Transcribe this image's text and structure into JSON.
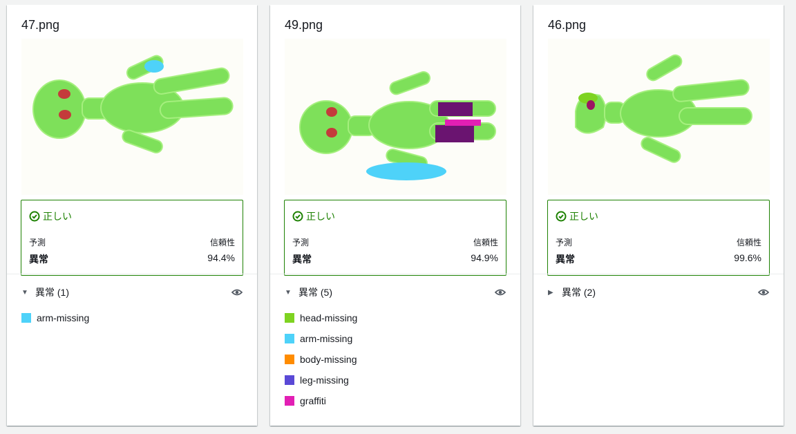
{
  "cards": [
    {
      "title": "47.png",
      "status": "正しい",
      "prediction_label": "予測",
      "confidence_label": "信頼性",
      "prediction_value": "異常",
      "confidence_value": "94.4%",
      "anomaly_header": "異常 (1)",
      "expanded": true,
      "labels": [
        {
          "name": "arm-missing",
          "color": "#4ed2f9"
        }
      ]
    },
    {
      "title": "49.png",
      "status": "正しい",
      "prediction_label": "予測",
      "confidence_label": "信頼性",
      "prediction_value": "異常",
      "confidence_value": "94.9%",
      "anomaly_header": "異常 (5)",
      "expanded": true,
      "labels": [
        {
          "name": "head-missing",
          "color": "#7ed321"
        },
        {
          "name": "arm-missing",
          "color": "#4ed2f9"
        },
        {
          "name": "body-missing",
          "color": "#ff8c00"
        },
        {
          "name": "leg-missing",
          "color": "#5a49d6"
        },
        {
          "name": "graffiti",
          "color": "#e21fb4"
        }
      ]
    },
    {
      "title": "46.png",
      "status": "正しい",
      "prediction_label": "予測",
      "confidence_label": "信頼性",
      "prediction_value": "異常",
      "confidence_value": "99.6%",
      "anomaly_header": "異常 (2)",
      "expanded": false,
      "labels": []
    }
  ],
  "colors": {
    "success": "#1d8102",
    "toy_green": "#7ee05a",
    "background": "#f2f3f3"
  },
  "icons": {
    "status": "check-circle-icon",
    "visibility": "eye-icon",
    "expanded": "caret-down-icon",
    "collapsed": "caret-right-icon"
  }
}
